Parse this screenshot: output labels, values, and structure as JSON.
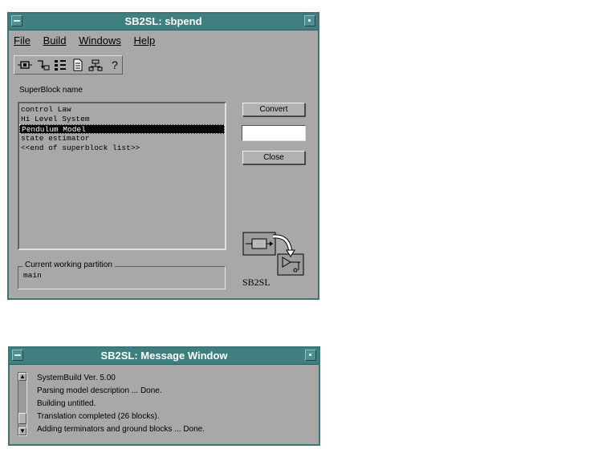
{
  "main_window": {
    "title": "SB2SL: sbpend",
    "menu": [
      "File",
      "Build",
      "Windows",
      "Help"
    ],
    "toolbar_icons": [
      "block-diagram-icon",
      "transform-icon",
      "grid-icon",
      "document-icon",
      "hierarchy-icon",
      "help-icon"
    ],
    "help_glyph": "?",
    "superblock_label": "SuperBlock name",
    "superblocks": [
      "control Law",
      "Hi Level System",
      "Pendulum Model",
      "state estimator",
      "<<end of superblock list>>"
    ],
    "selected_index": 2,
    "convert_label": "Convert",
    "convert_input_value": "",
    "close_label": "Close",
    "partition_label": "Current working partition",
    "partition_value": "main",
    "logo_text": "SB2SL"
  },
  "message_window": {
    "title": "SB2SL: Message Window",
    "lines": [
      "SystemBuild Ver. 5.00",
      "Parsing model description ... Done.",
      "Building untitled.",
      "Translation completed (26 blocks).",
      "Adding terminators and ground blocks ... Done."
    ]
  },
  "colors": {
    "titlebar": "#3f7f7f",
    "window_bg": "#a8a8a8",
    "selection": "#000000"
  }
}
